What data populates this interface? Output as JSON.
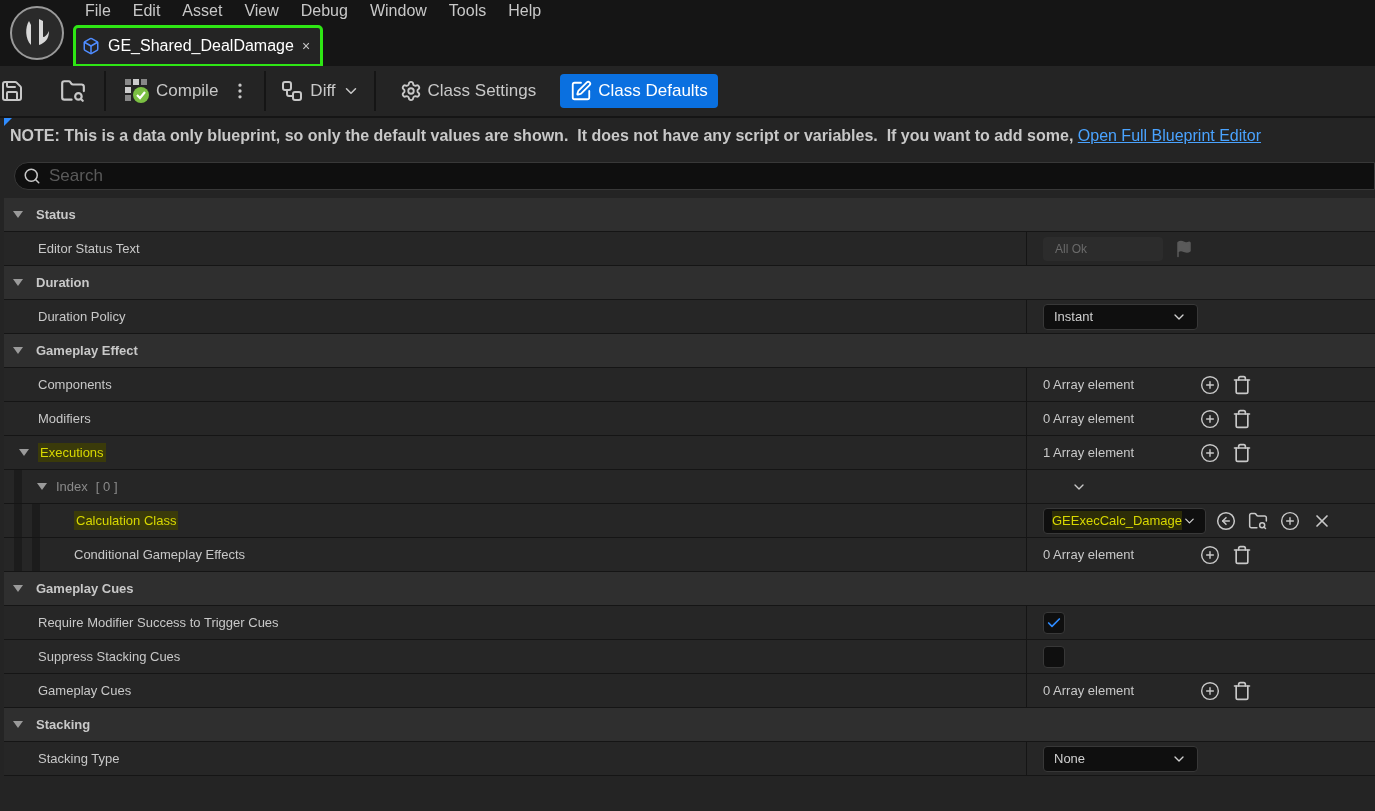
{
  "menu": [
    "File",
    "Edit",
    "Asset",
    "View",
    "Debug",
    "Window",
    "Tools",
    "Help"
  ],
  "tabs": [
    {
      "label": "GE_Shared_DealDamage",
      "close": "×",
      "selected": true,
      "highlighted": true
    }
  ],
  "toolbar": {
    "compile": "Compile",
    "diff": "Diff",
    "modes": [
      {
        "label": "Class Settings",
        "selected": false
      },
      {
        "label": "Class Defaults",
        "selected": true
      }
    ]
  },
  "note": {
    "text": "NOTE: This is a data only blueprint, so only the default values are shown.  It does not have any script or variables.  If you want to add some, ",
    "link": "Open Full Blueprint Editor"
  },
  "search": {
    "placeholder": "Search"
  },
  "sections": [
    {
      "title": "Status",
      "expanded": true,
      "rows": [
        {
          "label": "Editor Status Text",
          "kind": "status",
          "value": "All Ok"
        }
      ]
    },
    {
      "title": "Duration",
      "expanded": true,
      "rows": [
        {
          "label": "Duration Policy",
          "kind": "dropdown",
          "value": "Instant"
        }
      ]
    },
    {
      "title": "Gameplay Effect",
      "expanded": true,
      "rows": [
        {
          "label": "Components",
          "kind": "array",
          "value": "0 Array element"
        },
        {
          "label": "Modifiers",
          "kind": "array",
          "value": "0 Array element"
        },
        {
          "label": "Executions",
          "kind": "array",
          "value": "1 Array element",
          "highlighted": true,
          "expanded": true,
          "children": [
            {
              "label": "Index",
              "index": "[ 0 ]",
              "kind": "element",
              "expanded": true,
              "children": [
                {
                  "label": "Calculation Class",
                  "kind": "class",
                  "value": "GEExecCalc_Damage",
                  "highlighted": true
                },
                {
                  "label": "Conditional Gameplay Effects",
                  "kind": "array",
                  "value": "0 Array element"
                }
              ]
            }
          ]
        }
      ]
    },
    {
      "title": "Gameplay Cues",
      "expanded": true,
      "rows": [
        {
          "label": "Require Modifier Success to Trigger Cues",
          "kind": "checkbox",
          "checked": true
        },
        {
          "label": "Suppress Stacking Cues",
          "kind": "checkbox",
          "checked": false
        },
        {
          "label": "Gameplay Cues",
          "kind": "array",
          "value": "0 Array element"
        }
      ]
    },
    {
      "title": "Stacking",
      "expanded": true,
      "rows": [
        {
          "label": "Stacking Type",
          "kind": "dropdown",
          "value": "None"
        }
      ]
    }
  ]
}
